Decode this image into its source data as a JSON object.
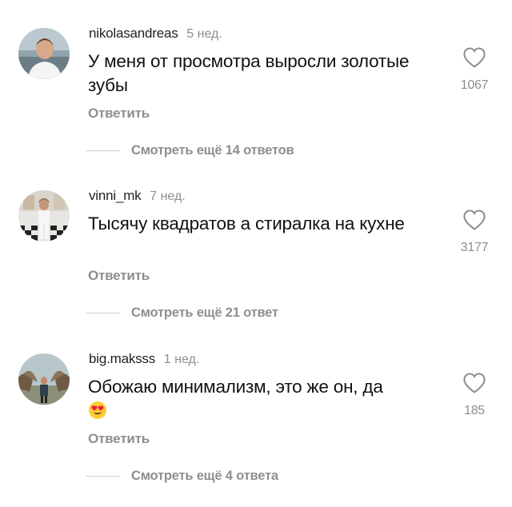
{
  "comments": [
    {
      "username": "nikolasandreas",
      "time": "5 нед.",
      "text": "У меня от просмотра выросли золотые зубы",
      "emoji": "",
      "reply_label": "Ответить",
      "likes": "1067",
      "more_replies": "Смотреть ещё 14 ответов"
    },
    {
      "username": "vinni_mk",
      "time": "7 нед.",
      "text": "Тысячу квадратов а стиралка на кухне",
      "emoji": "",
      "reply_label": "Ответить",
      "likes": "3177",
      "more_replies": "Смотреть ещё 21 ответ"
    },
    {
      "username": "big.maksss",
      "time": "1 нед.",
      "text": "Обожаю минимализм, это же он, да",
      "emoji": "heart-eyes-emoji",
      "reply_label": "Ответить",
      "likes": "185",
      "more_replies": "Смотреть ещё 4 ответа"
    }
  ],
  "icons": {
    "like": "heart-outline-icon"
  },
  "colors": {
    "secondary_text": "#8e8e8e",
    "primary_text": "#111111",
    "divider": "#d0d0d0"
  }
}
